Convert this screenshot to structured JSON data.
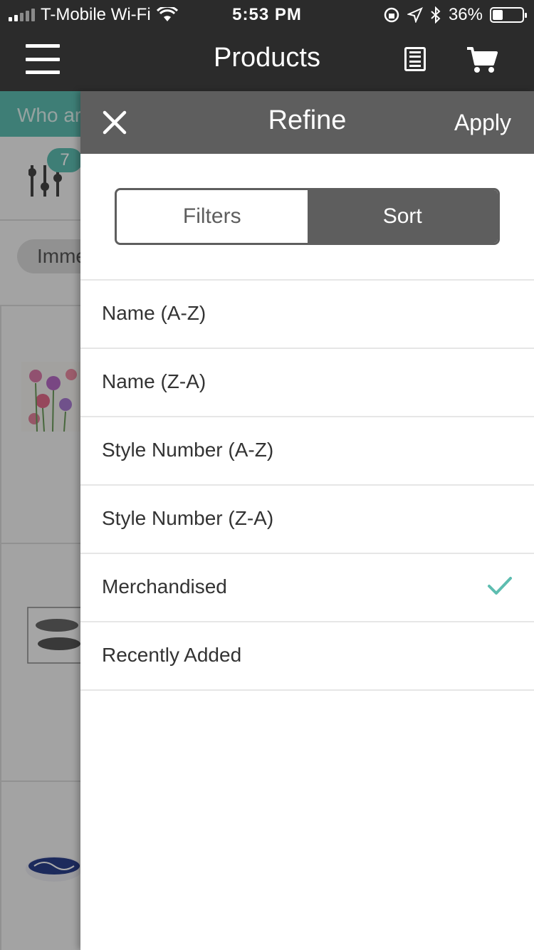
{
  "status_bar": {
    "carrier": "T-Mobile Wi-Fi",
    "time": "5:53 PM",
    "battery": "36%",
    "battery_level": 0.36
  },
  "header": {
    "title": "Products"
  },
  "background": {
    "banner_text": "Who ar",
    "filter_count": "7",
    "chip_text": "Imme"
  },
  "drawer": {
    "title": "Refine",
    "apply_label": "Apply",
    "tabs": [
      {
        "label": "Filters",
        "active": false
      },
      {
        "label": "Sort",
        "active": true
      }
    ],
    "sort_options": [
      {
        "label": "Name (A-Z)",
        "selected": false
      },
      {
        "label": "Name (Z-A)",
        "selected": false
      },
      {
        "label": "Style Number (A-Z)",
        "selected": false
      },
      {
        "label": "Style Number (Z-A)",
        "selected": false
      },
      {
        "label": "Merchandised",
        "selected": true
      },
      {
        "label": "Recently Added",
        "selected": false
      }
    ]
  },
  "colors": {
    "accent": "#5dbdb0",
    "header_dark": "#2b2b2b",
    "drawer_header": "#5e5e5e"
  }
}
